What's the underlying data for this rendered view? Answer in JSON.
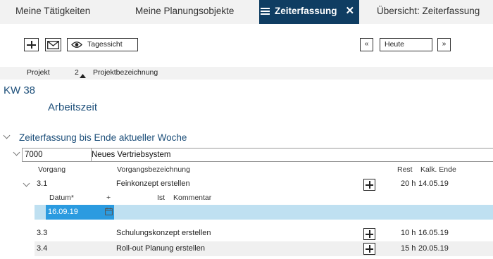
{
  "tabs": [
    {
      "label": "Meine Tätigkeiten"
    },
    {
      "label": "Meine Planungsobjekte"
    },
    {
      "label": "Zeiterfassung"
    },
    {
      "label": "Übersicht: Zeiterfassung"
    }
  ],
  "toolbar": {
    "view_label": "Tagessicht",
    "prev_label": "«",
    "today_value": "Heute",
    "next_label": "»"
  },
  "sort": {
    "col1": "Projekt",
    "col2_rank": "2",
    "col2": "Projektbezeichnung"
  },
  "week_label": "KW 38",
  "section_label": "Arbeitszeit",
  "group_label": "Zeiterfassung bis Ende aktueller Woche",
  "project": {
    "id": "7000",
    "name": "Neues Vertriebsystem"
  },
  "columns": {
    "vorgang": "Vorgang",
    "bezeichnung": "Vorgangsbezeichnung",
    "rest": "Rest",
    "kalk_ende": "Kalk. Ende"
  },
  "rows": [
    {
      "vorgang": "3.1",
      "bezeichnung": "Feinkonzept erstellen",
      "rest": "20 h",
      "kalk_ende": "14.05.19"
    },
    {
      "vorgang": "3.3",
      "bezeichnung": "Schulungskonzept erstellen",
      "rest": "10 h",
      "kalk_ende": "16.05.19"
    },
    {
      "vorgang": "3.4",
      "bezeichnung": "Roll-out Planung erstellen",
      "rest": "15 h",
      "kalk_ende": "20.05.19"
    }
  ],
  "entry": {
    "datum_label": "Datum*",
    "plus_label": "+",
    "ist_label": "Ist",
    "kommentar_label": "Kommentar",
    "datum_value": "16.09.19"
  },
  "icons": {
    "menu": "hamburger-icon",
    "close": "close-icon",
    "add": "plus-icon",
    "mail": "envelope-icon",
    "view": "eye-icon",
    "calendar": "calendar-icon",
    "chevron": "chevron-down-icon",
    "sort": "sort-up-triangle-icon"
  },
  "colors": {
    "active_tab": "#0f3d62",
    "accent_text": "#1d4f7a",
    "selected_row": "#bfe0f1",
    "date_field": "#2b9be0"
  }
}
